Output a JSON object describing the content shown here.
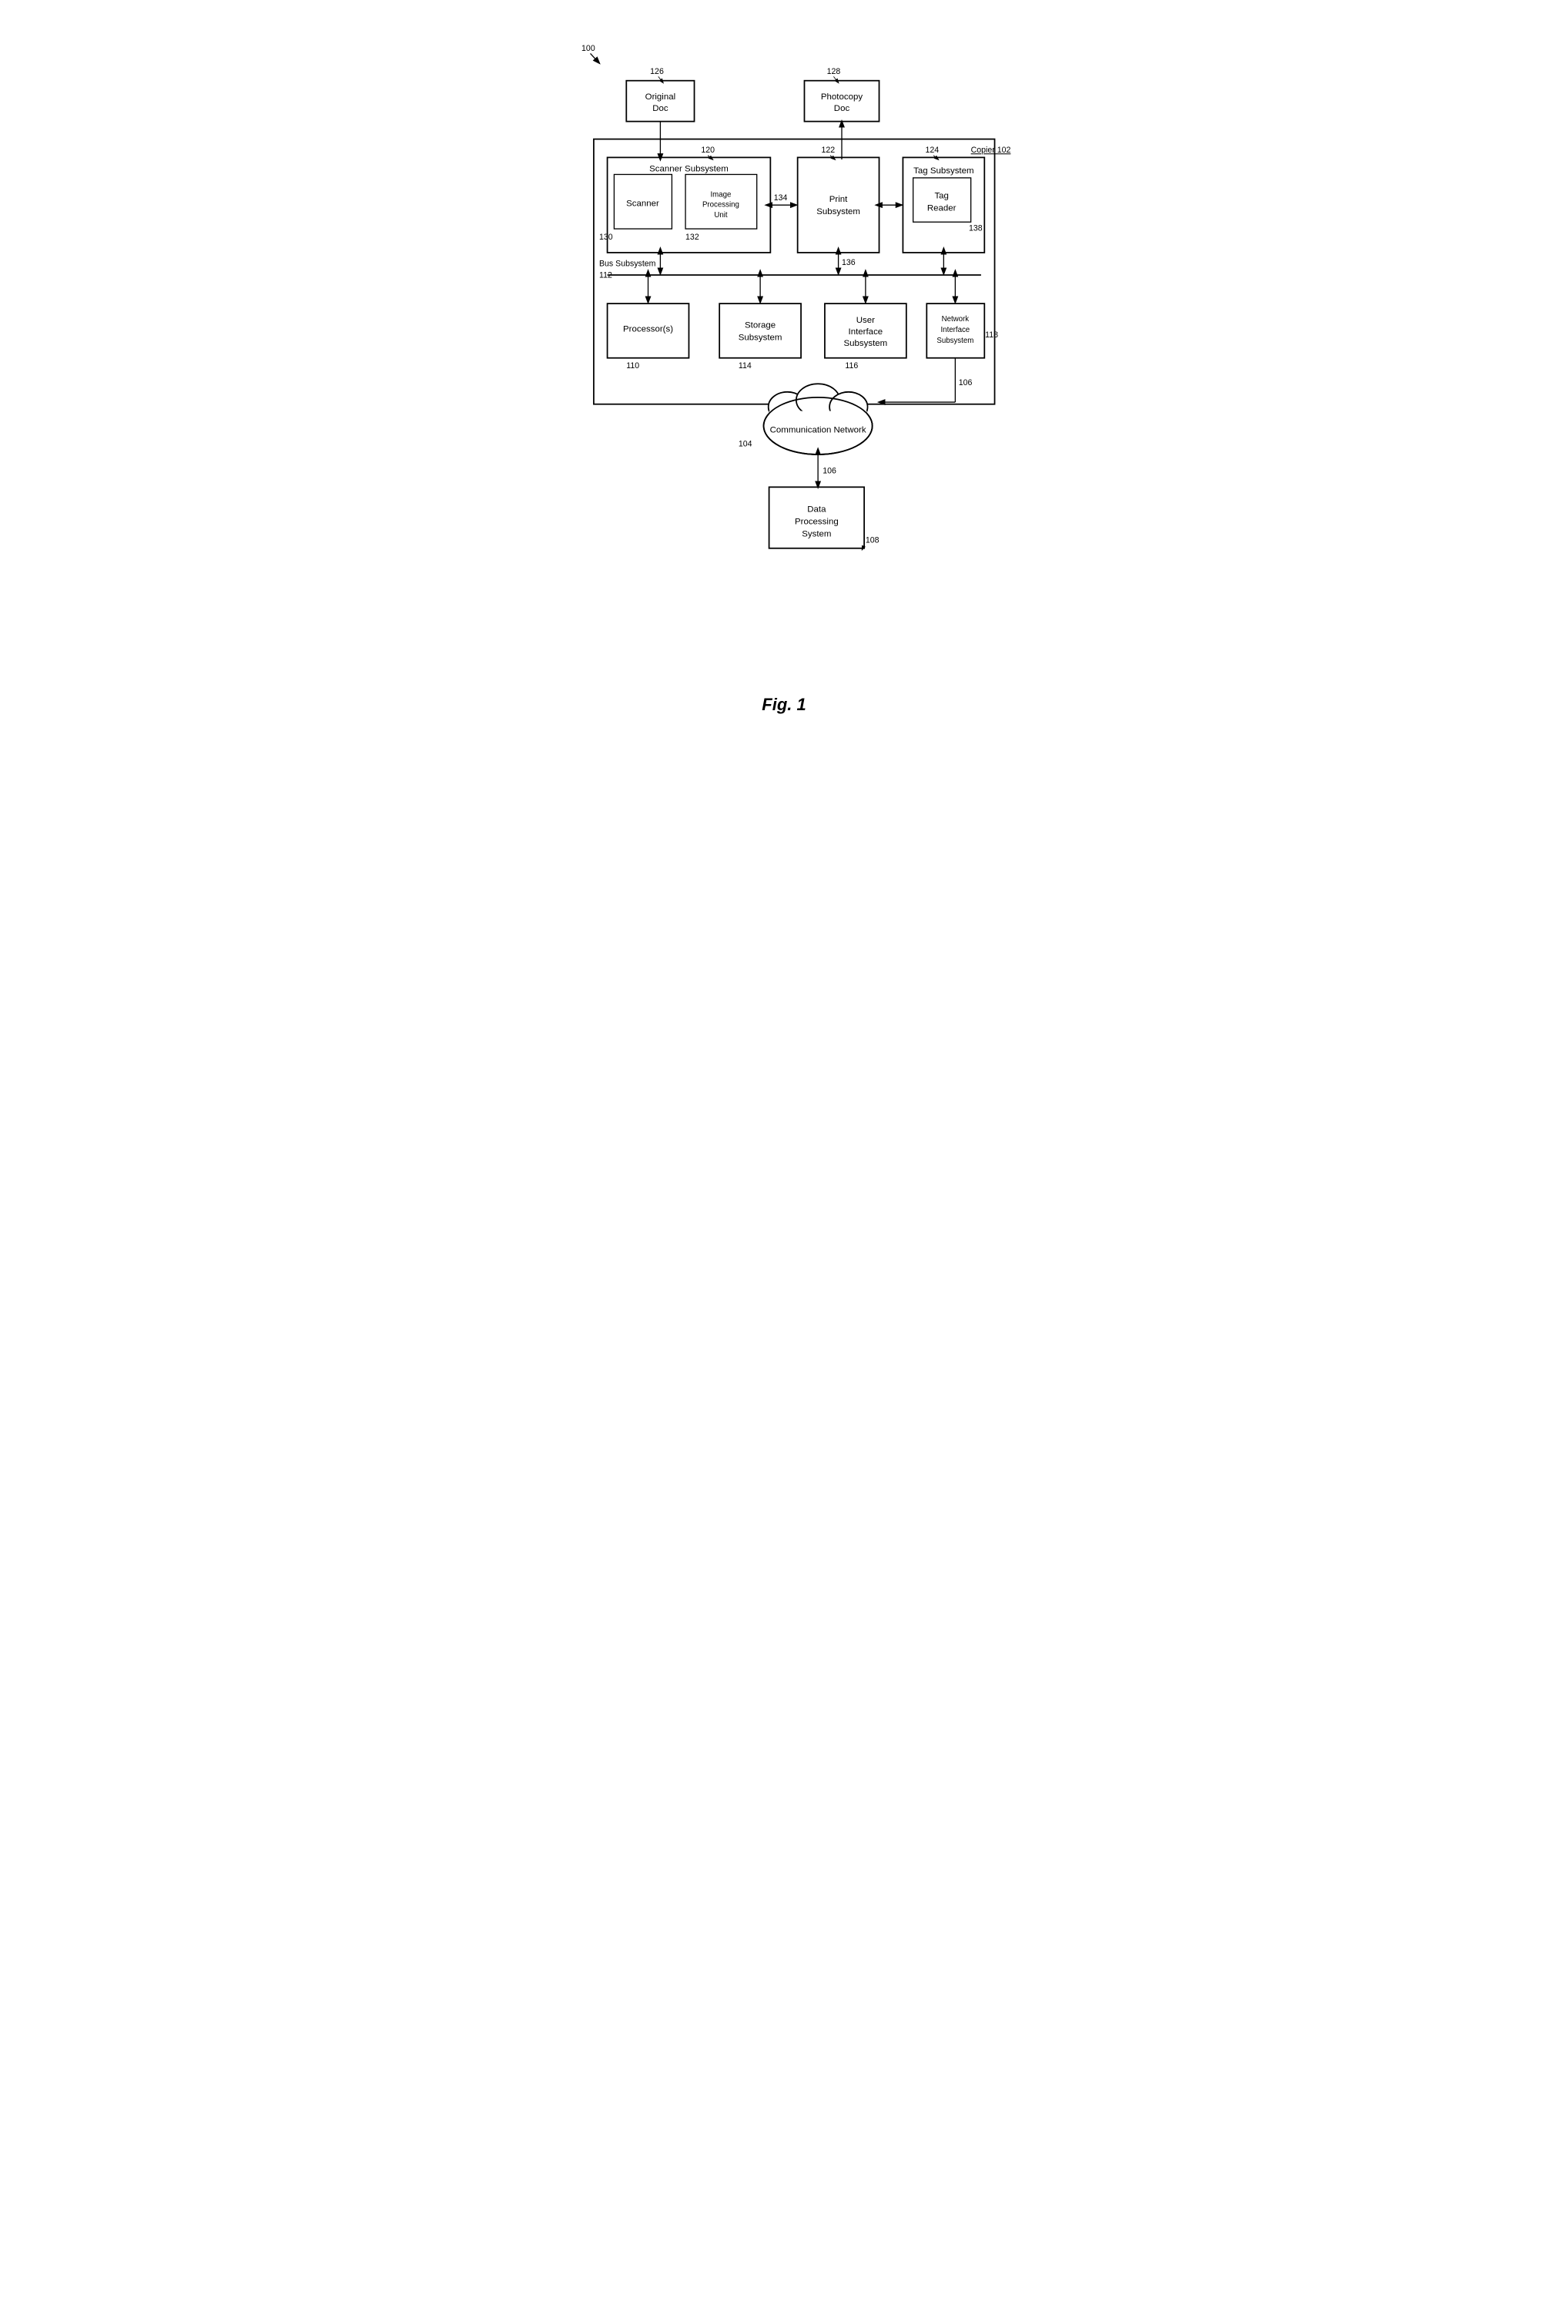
{
  "figure": {
    "label": "Fig. 1",
    "fig_number": "100",
    "nodes": {
      "original_doc": {
        "label": "Original\nDoc",
        "ref": "126"
      },
      "photocopy_doc": {
        "label": "Photocopy\nDoc",
        "ref": "128"
      },
      "copier": {
        "label": "Copier 102"
      },
      "scanner_subsystem": {
        "label": "Scanner Subsystem",
        "ref": "120"
      },
      "scanner": {
        "label": "Scanner",
        "ref": "130"
      },
      "image_processing": {
        "label": "Image\nProcessing\nUnit",
        "ref": "132"
      },
      "print_subsystem": {
        "label": "Print\nSubsystem",
        "ref": "122"
      },
      "tag_subsystem": {
        "label": "Tag Subsystem",
        "ref": "124"
      },
      "tag_reader": {
        "label": "Tag\nReader",
        "ref": "138"
      },
      "bus_subsystem": {
        "label": "Bus Subsystem",
        "ref": "112"
      },
      "processors": {
        "label": "Processor(s)",
        "ref": "110"
      },
      "storage_subsystem": {
        "label": "Storage\nSubsystem",
        "ref": "114"
      },
      "user_interface": {
        "label": "User\nInterface\nSubsystem",
        "ref": "116"
      },
      "network_interface": {
        "label": "Network\nInterface\nSubsystem",
        "ref": "118"
      },
      "communication_network": {
        "label": "Communication Network",
        "ref": "104"
      },
      "data_processing": {
        "label": "Data\nProcessing\nSystem",
        "ref": "108"
      },
      "arrow_106_top": {
        "ref": "106"
      },
      "arrow_106_bot": {
        "ref": "106"
      },
      "arrow_134": {
        "ref": "134"
      },
      "arrow_136": {
        "ref": "136"
      }
    }
  }
}
